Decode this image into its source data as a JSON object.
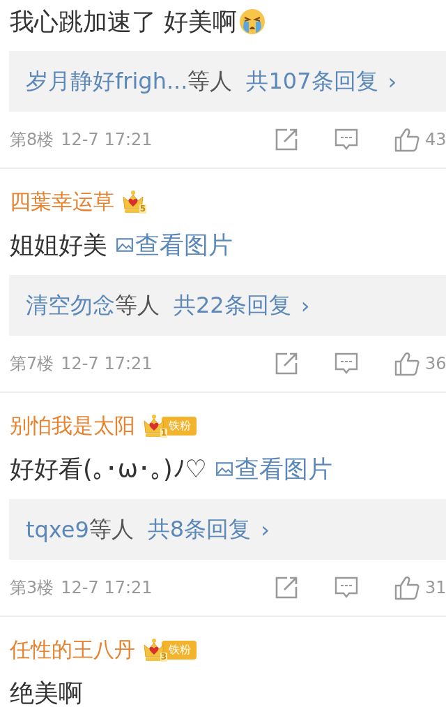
{
  "comments": [
    {
      "text": "我心跳加速了 好美啊",
      "crying_emoji": true,
      "replies": {
        "names": "岁月静好frigh...",
        "suffix": "等人",
        "total": "共107条回复",
        "chevron": "›"
      },
      "floor": "第8楼",
      "time": "12-7 17:21",
      "likes": "43"
    },
    {
      "username": "四葉幸运草",
      "badge": {
        "level": "5"
      },
      "text": "姐姐好美",
      "image_link": "查看图片",
      "replies": {
        "names": "清空勿念",
        "suffix": "等人",
        "total": "共22条回复",
        "chevron": "›"
      },
      "floor": "第7楼",
      "time": "12-7 17:21",
      "likes": "36"
    },
    {
      "username": "别怕我是太阳",
      "badge": {
        "level": "1",
        "label": "铁粉"
      },
      "text": "好好看(｡･ω･｡)ﾉ♡",
      "image_link": "查看图片",
      "replies": {
        "names": "tqxe9",
        "suffix": "等人",
        "total": "共8条回复",
        "chevron": "›"
      },
      "floor": "第3楼",
      "time": "12-7 17:21",
      "likes": "31"
    },
    {
      "username": "任性的王八丹",
      "badge": {
        "level": "3",
        "label": "铁粉"
      },
      "text": "绝美啊"
    }
  ]
}
